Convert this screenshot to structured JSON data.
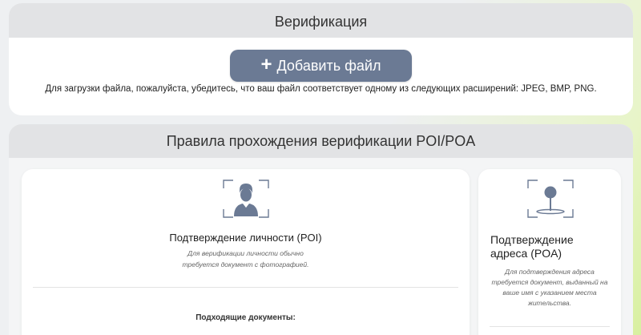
{
  "verification": {
    "title": "Верификация",
    "add_file_label": "Добавить файл",
    "hint": "Для загрузки файла, пожалуйста, убедитесь, что ваш файл соответствует одному из следующих расширений: JPEG, BMP, PNG."
  },
  "rules": {
    "title": "Правила прохождения верификации POI/POA",
    "poi": {
      "icon": "person-id-icon",
      "title": "Подтверждение личности (POI)",
      "desc_line1": "Для верификации личности обычно",
      "desc_line2": "требуется документ с фотографией.",
      "docs_title": "Подходящие документы:"
    },
    "poa": {
      "icon": "location-pin-icon",
      "title_line1": "Подтверждение",
      "title_line2": "адреса (POA)",
      "desc_line1": "Для подтверждения адреса",
      "desc_line2": "требуется документ, выданный на",
      "desc_line3": "ваше имя с указанием места",
      "desc_line4": "жительства."
    }
  },
  "colors": {
    "button": "#6b7a94",
    "icon": "#6b7a94",
    "header_bg": "#e2e3e5"
  }
}
